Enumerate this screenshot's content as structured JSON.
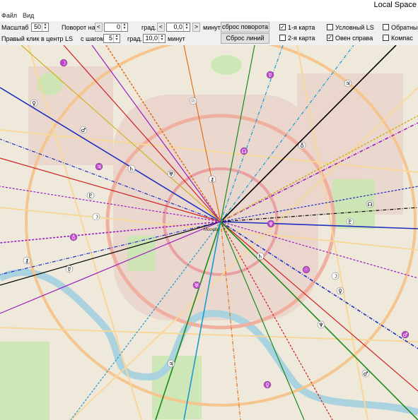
{
  "window": {
    "title": "Local Space"
  },
  "menu": {
    "items": [
      "Файл",
      "Вид"
    ]
  },
  "toolbar": {
    "scale_label": "Масштаб",
    "scale_value": "50",
    "rotate_label": "Поворот на",
    "rotate_deg_value": "0",
    "deg_unit": "град.",
    "rotate_min_value": "0,0",
    "min_unit": "минут",
    "reset_rotation": "сброс поворота",
    "right_click_label": "Правый клик в центр LS",
    "step_label": "с шагом",
    "step_deg_value": "5",
    "step_deg_unit": "град.",
    "step_min_value": "10,0",
    "step_min_unit": "минут",
    "reset_lines": "Сброс линий",
    "left_arrow": "<",
    "right_arrow": ">",
    "check_mark": "✓"
  },
  "options": {
    "map1": {
      "label": "1-я карта",
      "checked": true
    },
    "map2": {
      "label": "2-я карта",
      "checked": false
    },
    "conditional": {
      "label": "Условный LS",
      "checked": false
    },
    "aries": {
      "label": "Овен справа",
      "checked": true
    },
    "reverse": {
      "label": "Обратные",
      "checked": false
    },
    "compass": {
      "label": "Компас",
      "checked": false
    }
  },
  "map": {
    "center_label": "Москва",
    "line_colors": [
      "#1f2fbf",
      "#d01f1f",
      "#1a8a1a",
      "#e0701a",
      "#1a9ad0",
      "#000000",
      "#9a1fbf",
      "#d0b01f"
    ],
    "glyphs": [
      "☽",
      "♀",
      "♂",
      "♃",
      "♄",
      "♅",
      "♆",
      "♇",
      "☊",
      "♁",
      "⚷",
      "☿",
      "☉"
    ]
  }
}
